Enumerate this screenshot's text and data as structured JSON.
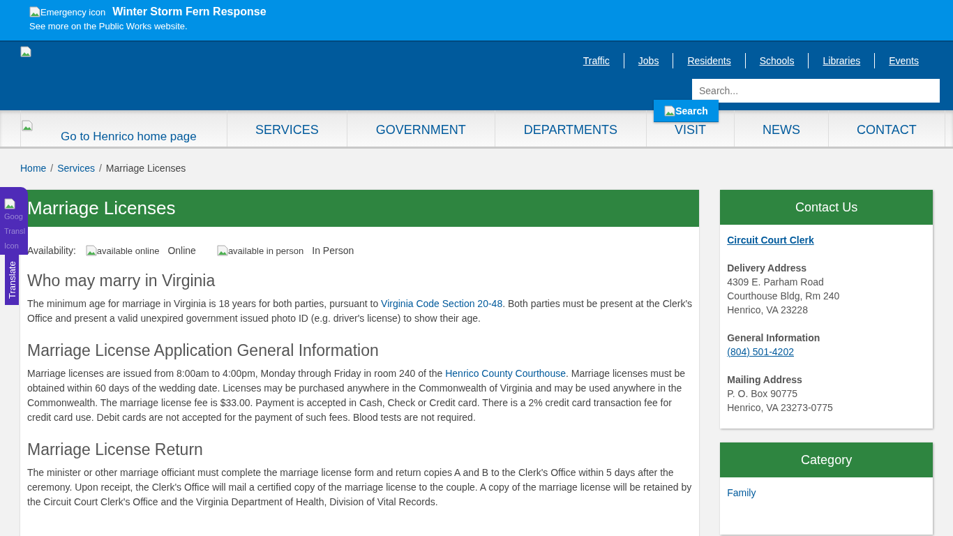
{
  "alert": {
    "icon_alt": "Emergency icon",
    "title": "Winter Storm Fern Response",
    "subtitle": "See more on the Public Works website."
  },
  "top_links": [
    "Traffic",
    "Jobs",
    "Residents",
    "Schools",
    "Libraries",
    "Events"
  ],
  "search": {
    "placeholder": "Search...",
    "button": "Search"
  },
  "nav": {
    "home_alt": "Go to Henrico home page",
    "items": [
      "SERVICES",
      "GOVERNMENT",
      "DEPARTMENTS",
      "VISIT",
      "NEWS",
      "CONTACT"
    ]
  },
  "breadcrumb": {
    "links": [
      {
        "label": "Home",
        "separator": "/"
      },
      {
        "label": "Services",
        "separator": "/"
      }
    ],
    "current": "Marriage Licenses"
  },
  "translate": {
    "alt_lines": [
      "Goog",
      "Transl",
      "Icon"
    ],
    "label": "Translate"
  },
  "page_title": "Marriage Licenses",
  "availability": {
    "label": "Availability:",
    "options": [
      {
        "alt": "available online",
        "label": "Online"
      },
      {
        "alt": "available in person",
        "label": "In Person"
      }
    ]
  },
  "sections": [
    {
      "heading": "Who may marry in Virginia",
      "parts": [
        {
          "text": "The minimum age for marriage in Virginia is 18 years for both parties, pursuant to "
        },
        {
          "link": "Virginia Code Section 20-48"
        },
        {
          "text": ". Both parties must be present at the Clerk's Office and present a valid unexpired government issued photo ID (e.g. driver's license) to show their age."
        }
      ]
    },
    {
      "heading": "Marriage License Application General Information",
      "parts": [
        {
          "text": "Marriage licenses are issued from 8:00am to 4:00pm, Monday through Friday in room 240 of the "
        },
        {
          "link": "Henrico County Courthouse"
        },
        {
          "text": ". Marriage licenses must be obtained within 60 days of the wedding date. Licenses may be purchased anywhere in the Commonwealth of Virginia and may be used anywhere in the Commonwealth. The marriage license fee is $33.00. Payment is accepted in Cash, Check or Credit card. There is a 2% credit card transaction fee for credit card use. Debit cards are not accepted for the payment of such fees. Blood tests are not required."
        }
      ]
    },
    {
      "heading": "Marriage License Return",
      "parts": [
        {
          "text": "The minister or other marriage officiant must complete the marriage license form and return copies A and B to the Clerk's Office within 5 days after the ceremony. Upon receipt, the Clerk's Office will mail a certified copy of the marriage license to the couple. A copy of the marriage license will be retained by the Circuit Court Clerk's Office and the Virginia Department of Health, Division of Vital Records."
        }
      ]
    }
  ],
  "contact": {
    "title": "Contact Us",
    "office": "Circuit Court Clerk",
    "groups": [
      {
        "label": "Delivery Address",
        "lines": [
          "4309 E. Parham Road",
          "Courthouse Bldg, Rm 240",
          "Henrico, VA 23228"
        ]
      },
      {
        "label": "General Information",
        "phone": "(804) 501-4202"
      },
      {
        "label": "Mailing Address",
        "lines": [
          "P. O. Box 90775",
          "Henrico, VA 23273-0775"
        ]
      }
    ]
  },
  "category": {
    "title": "Category",
    "items": [
      "Family"
    ]
  }
}
